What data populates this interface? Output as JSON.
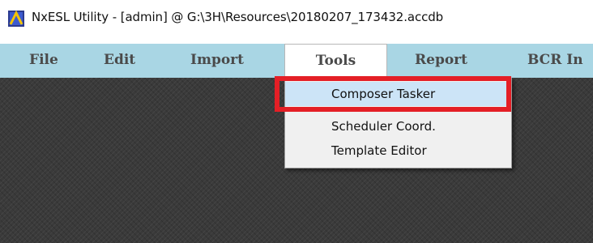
{
  "window": {
    "title": "NxESL Utility - [admin] @ G:\\3H\\Resources\\20180207_173432.accdb",
    "icon": "app-icon"
  },
  "menubar": {
    "items": [
      {
        "label": "File"
      },
      {
        "label": "Edit"
      },
      {
        "label": "Import"
      },
      {
        "label": "Tools",
        "active": true
      },
      {
        "label": "Report"
      },
      {
        "label": "BCR In"
      }
    ]
  },
  "dropdown": {
    "items": [
      {
        "label": "Composer Tasker",
        "highlighted": true
      },
      {
        "label": "Scheduler Coord."
      },
      {
        "label": "Template  Editor"
      }
    ]
  },
  "colors": {
    "menubar": "#a9d6e4",
    "highlight": "#cce4f7",
    "annotation": "#e41f26"
  }
}
